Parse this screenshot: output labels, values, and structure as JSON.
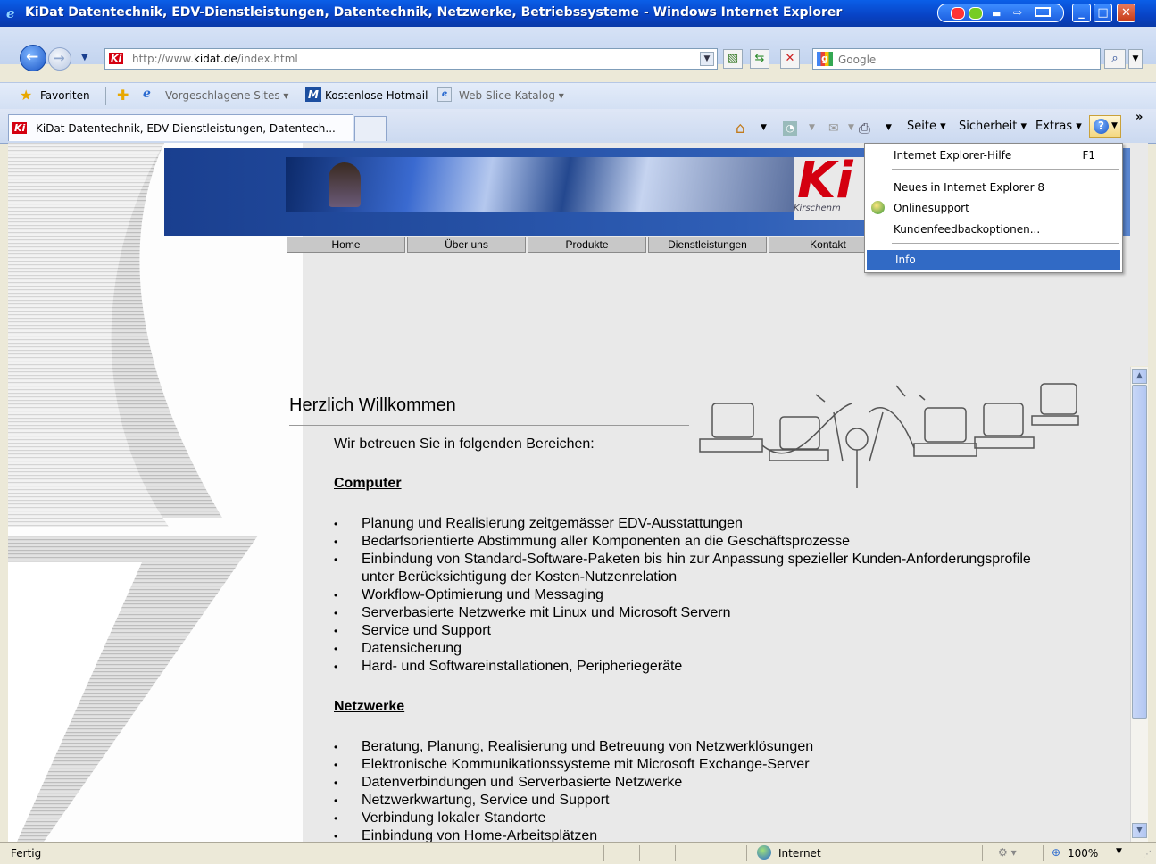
{
  "window": {
    "title": "KiDat Datentechnik, EDV-Dienstleistungen, Datentechnik, Netzwerke, Betriebssysteme - Windows Internet Explorer"
  },
  "address": {
    "url_prefix": "http://www.",
    "url_domain": "kidat.de",
    "url_path": "/index.html"
  },
  "search": {
    "placeholder": "Google"
  },
  "favorites": {
    "favoriten_label": "Favoriten",
    "suggested_label": "Vorgeschlagene Sites",
    "hotmail_label": "Kostenlose Hotmail",
    "webslice_label": "Web Slice-Katalog"
  },
  "tab": {
    "title": "KiDat Datentechnik, EDV-Dienstleistungen, Datentech..."
  },
  "command": {
    "seite": "Seite",
    "sicherheit": "Sicherheit",
    "extras": "Extras"
  },
  "help_menu": {
    "items": [
      {
        "label": "Internet Explorer-Hilfe",
        "shortcut": "F1"
      },
      {
        "label": "Neues in Internet Explorer 8"
      },
      {
        "label": "Onlinesupport"
      },
      {
        "label": "Kundenfeedbackoptionen..."
      },
      {
        "label": "Info"
      }
    ]
  },
  "site": {
    "logo_text": "Ki",
    "logo_sub": "Kirschenm",
    "nav": [
      "Home",
      "Über uns",
      "Produkte",
      "Dienstleistungen",
      "Kontakt"
    ],
    "heading": "Herzlich Willkommen",
    "intro": "Wir betreuen Sie in folgenden Bereichen:",
    "section1_title": "Computer",
    "section1_items": [
      "Planung und Realisierung zeitgemässer EDV-Ausstattungen",
      "Bedarfsorientierte Abstimmung aller Komponenten an die Geschäftsprozesse",
      "Einbindung von Standard-Software-Paketen bis hin zur Anpassung spezieller Kunden-Anforderungsprofile unter Berücksichtigung der Kosten-Nutzenrelation",
      "Workflow-Optimierung und Messaging",
      "Serverbasierte Netzwerke mit Linux und Microsoft Servern",
      "Service und Support",
      "Datensicherung",
      "Hard- und Softwareinstallationen, Peripheriegeräte"
    ],
    "section2_title": "Netzwerke",
    "section2_items": [
      "Beratung, Planung, Realisierung und Betreuung von Netzwerklösungen",
      "Elektronische Kommunikationssysteme mit Microsoft Exchange-Server",
      "Datenverbindungen und Serverbasierte Netzwerke",
      "Netzwerkwartung, Service und Support",
      "Verbindung lokaler Standorte",
      "Einbindung von Home-Arbeitsplätzen"
    ]
  },
  "status": {
    "text": "Fertig",
    "zone": "Internet",
    "zoom": "100%"
  },
  "colors": {
    "titlebar": "#0842c4",
    "menu_highlight": "#316ac5",
    "banner": "#1a3f8f",
    "logo_red": "#d40010"
  }
}
